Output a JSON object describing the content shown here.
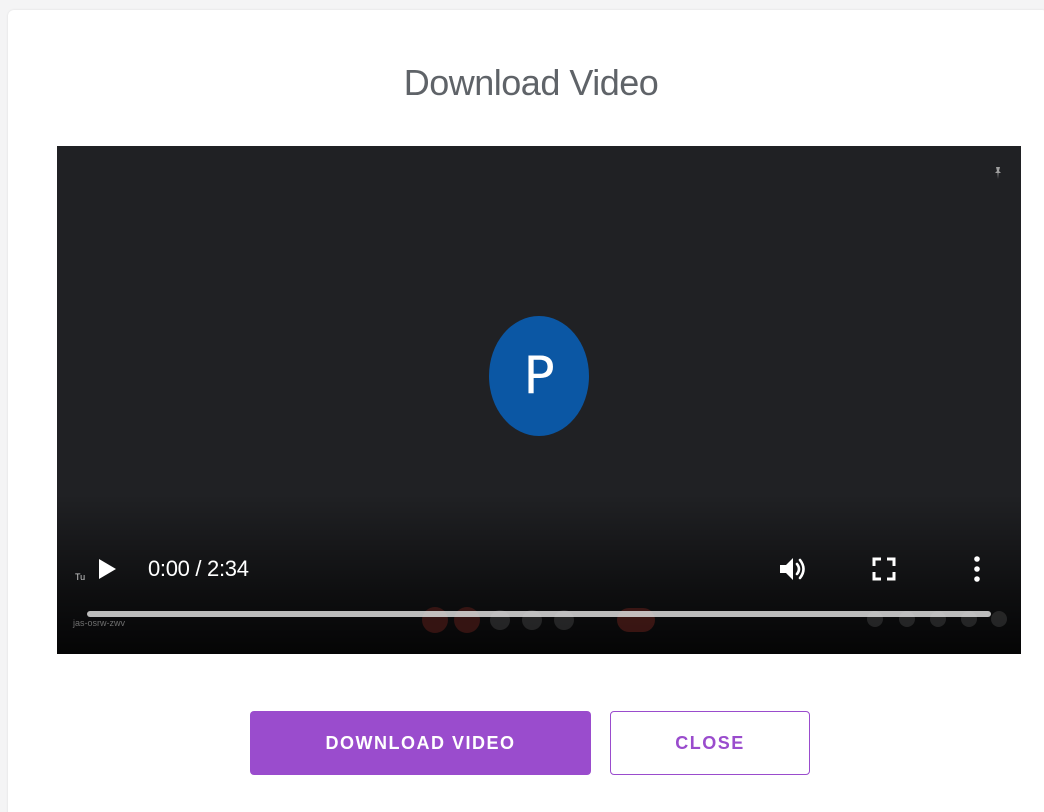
{
  "modal": {
    "title": "Download Video"
  },
  "video": {
    "avatar_letter": "P",
    "corner_label": "Tu",
    "time_display": "0:00 / 2:34",
    "progress": 0.0,
    "meeting_code": "jas-osrw-zwv",
    "icons": {
      "play": "play-icon",
      "volume": "volume-icon",
      "fullscreen": "fullscreen-icon",
      "more": "more-vert-icon",
      "pin": "pin-icon"
    }
  },
  "actions": {
    "download_label": "DOWNLOAD VIDEO",
    "close_label": "CLOSE"
  },
  "colors": {
    "accent": "#9a4ccd",
    "avatar": "#0b57a4",
    "video_bg": "#202124",
    "title_text": "#5f6368"
  }
}
